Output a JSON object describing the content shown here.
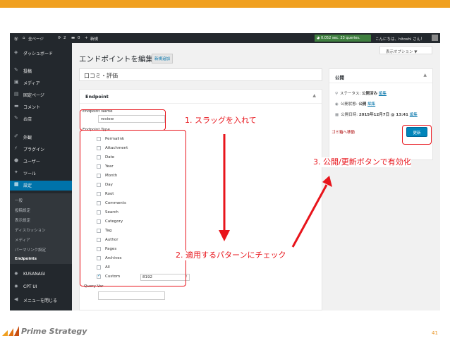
{
  "admin_bar": {
    "site_name": "全ページ",
    "updates": "2",
    "comments": "0",
    "new_label": "新規",
    "queries": "0.052 sec. 23 queries.",
    "greeting": "こんにちは、hitoshi さん！"
  },
  "sidebar": {
    "items": [
      {
        "icon": "dashboard-icon",
        "glyph": "◈",
        "label": "ダッシュボード"
      },
      {
        "icon": "pin-icon",
        "glyph": "✎",
        "label": "投稿"
      },
      {
        "icon": "media-icon",
        "glyph": "▣",
        "label": "メディア"
      },
      {
        "icon": "page-icon",
        "glyph": "▤",
        "label": "固定ページ"
      },
      {
        "icon": "comment-icon",
        "glyph": "▬",
        "label": "コメント"
      },
      {
        "icon": "pin-icon",
        "glyph": "✎",
        "label": "お店"
      },
      {
        "icon": "brush-icon",
        "glyph": "✐",
        "label": "外観"
      },
      {
        "icon": "plugin-icon",
        "glyph": "⚡",
        "label": "プラグイン"
      },
      {
        "icon": "user-icon",
        "glyph": "●",
        "label": "ユーザー"
      },
      {
        "icon": "wrench-icon",
        "glyph": "✦",
        "label": "ツール"
      },
      {
        "icon": "settings-icon",
        "glyph": "▦",
        "label": "設定"
      }
    ],
    "sub_items": [
      "一般",
      "投稿設定",
      "表示設定",
      "ディスカッション",
      "メディア",
      "パーマリンク設定",
      "Endpoints"
    ],
    "bottom_items": [
      {
        "icon": "gear-icon",
        "glyph": "✹",
        "label": "KUSANAGI"
      },
      {
        "icon": "gear-icon",
        "glyph": "✹",
        "label": "CPT UI"
      },
      {
        "icon": "collapse-icon",
        "glyph": "◀",
        "label": "メニューを閉じる"
      }
    ]
  },
  "header": {
    "title": "エンドポイントを編集",
    "add_new": "新規追加",
    "screen_options": "表示オプション ▼"
  },
  "post": {
    "title": "口コミ・評価"
  },
  "endpoint": {
    "heading": "Endpoint",
    "name_label": "Endpoint Name",
    "name_value": "review",
    "type_label": "Endpoint Type",
    "types": [
      {
        "label": "Permalink",
        "checked": false
      },
      {
        "label": "Attachment",
        "checked": false
      },
      {
        "label": "Date",
        "checked": false
      },
      {
        "label": "Year",
        "checked": false
      },
      {
        "label": "Month",
        "checked": false
      },
      {
        "label": "Day",
        "checked": false
      },
      {
        "label": "Root",
        "checked": false
      },
      {
        "label": "Comments",
        "checked": false
      },
      {
        "label": "Search",
        "checked": false
      },
      {
        "label": "Category",
        "checked": false
      },
      {
        "label": "Tag",
        "checked": false
      },
      {
        "label": "Author",
        "checked": false
      },
      {
        "label": "Pages",
        "checked": false
      },
      {
        "label": "Archives",
        "checked": false
      },
      {
        "label": "All",
        "checked": false
      },
      {
        "label": "Custom",
        "checked": true
      }
    ],
    "custom_value": "8192",
    "query_var_label": "Query Var"
  },
  "publish": {
    "heading": "公開",
    "status_label": "ステータス:",
    "status_value": "公開済み",
    "visibility_label": "公開状態:",
    "visibility_value": "公開",
    "date_label": "公開日時:",
    "date_value": "2015年12月7日 @ 13:41",
    "edit_link": "編集",
    "trash": "ゴミ箱へ移動",
    "update": "更新"
  },
  "annotations": {
    "step1": "1. スラッグを入れて",
    "step2": "2. 適用するパターンにチェック",
    "step3": "3. 公開/更新ボタンで有効化"
  },
  "footer": {
    "brand": "Prime Strategy",
    "page_number": "41"
  },
  "colors": {
    "accent_orange": "#f0a020",
    "annotation_red": "#e8141b",
    "admin_dark": "#23282d",
    "wp_blue": "#0073aa"
  }
}
